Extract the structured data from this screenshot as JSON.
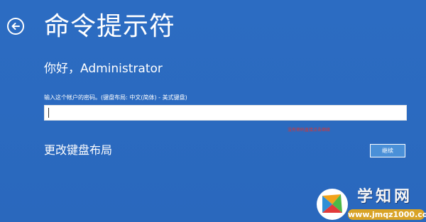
{
  "header": {
    "back_icon": "back-arrow-icon",
    "title": "命令提示符"
  },
  "login": {
    "greeting": "你好，Administrator",
    "password_hint": "输入这个帐户的密码。(键盘布局: 中文(简体) - 美式键盘)",
    "password_value": "",
    "annotation": "没有密码直接点击继续",
    "change_layout_label": "更改键盘布局",
    "continue_label": "继续"
  },
  "watermark": {
    "title": "学知网",
    "domain": "www.jmqz1000.com"
  },
  "colors": {
    "background": "#2b6bc0",
    "continue_button": "#4a90d8",
    "annotation": "#e2332b",
    "watermark_domain_bg": "#d9a326"
  }
}
